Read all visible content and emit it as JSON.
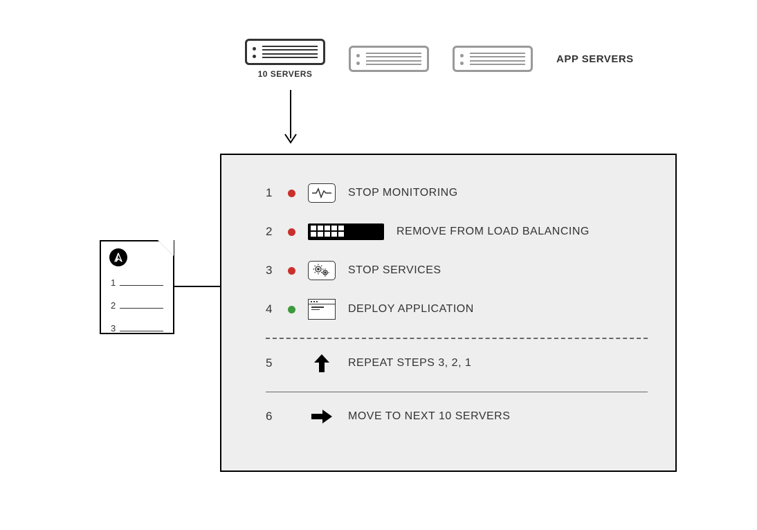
{
  "top": {
    "server_caption": "10 SERVERS",
    "app_servers_label": "APP SERVERS"
  },
  "playbook": {
    "list_numbers": [
      "1",
      "2",
      "3"
    ]
  },
  "steps": [
    {
      "num": "1",
      "dot": "red",
      "icon": "monitor",
      "label": "STOP MONITORING"
    },
    {
      "num": "2",
      "dot": "red",
      "icon": "lb",
      "label": "REMOVE FROM LOAD BALANCING"
    },
    {
      "num": "3",
      "dot": "red",
      "icon": "gears",
      "label": "STOP SERVICES"
    },
    {
      "num": "4",
      "dot": "green",
      "icon": "window",
      "label": "DEPLOY APPLICATION"
    },
    {
      "num": "5",
      "dot": "none",
      "icon": "arrow-up",
      "label": "REPEAT STEPS 3, 2, 1"
    },
    {
      "num": "6",
      "dot": "none",
      "icon": "arrow-right",
      "label": "MOVE TO NEXT 10 SERVERS"
    }
  ]
}
